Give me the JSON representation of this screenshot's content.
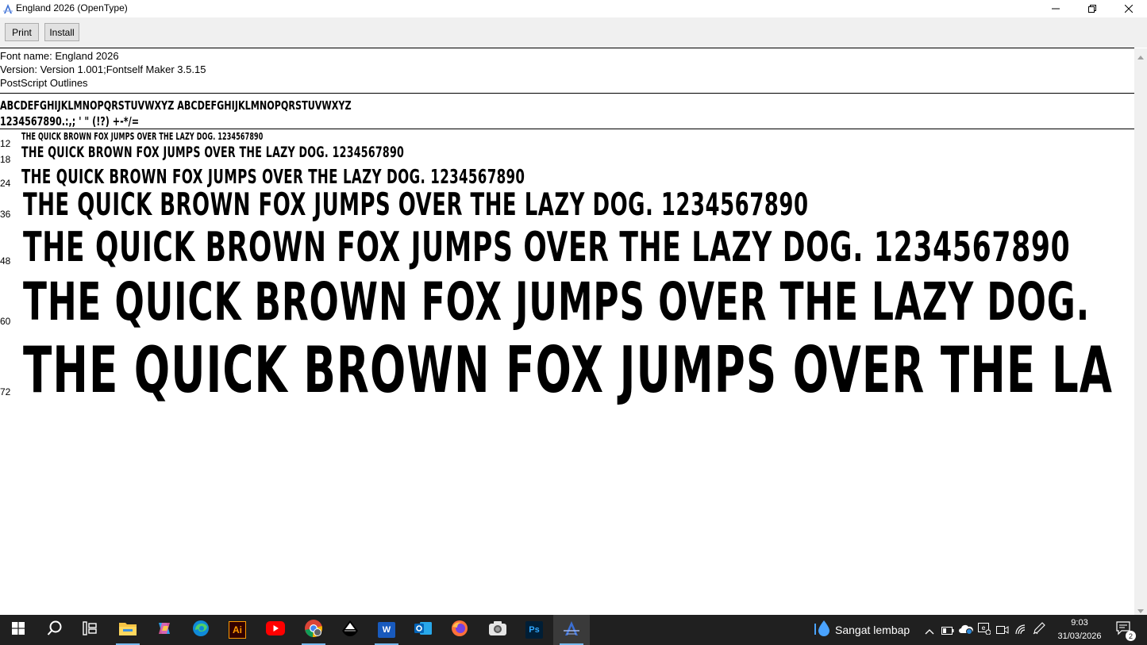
{
  "window": {
    "title": "England 2026 (OpenType)",
    "controls": {
      "minimize_icon": "minimize-icon",
      "restore_icon": "restore-icon",
      "close_icon": "close-icon"
    }
  },
  "toolbar": {
    "print_label": "Print",
    "install_label": "Install"
  },
  "font_info": {
    "name_line": "Font name: England 2026",
    "version_line": "Version: Version 1.001;Fontself Maker 3.5.15",
    "outline_line": "PostScript Outlines"
  },
  "charset": {
    "line1": "ABCDEFGHIJKLMNOPQRSTUVWXYZ ABCDEFGHIJKLMNOPQRSTUVWXYZ",
    "line2": "1234567890.:,; ' \" (!?) +-*/="
  },
  "samples": [
    {
      "size": "12",
      "text": "THE QUICK BROWN FOX JUMPS OVER THE LAZY DOG. 1234567890"
    },
    {
      "size": "18",
      "text": "THE QUICK BROWN FOX JUMPS OVER THE LAZY DOG. 1234567890"
    },
    {
      "size": "24",
      "text": "THE QUICK BROWN FOX JUMPS OVER THE LAZY DOG. 1234567890"
    },
    {
      "size": "36",
      "text": "THE QUICK BROWN FOX JUMPS OVER THE LAZY DOG. 1234567890"
    },
    {
      "size": "48",
      "text": "THE QUICK BROWN FOX JUMPS OVER THE LAZY DOG. 1234567890"
    },
    {
      "size": "60",
      "text": "THE QUICK BROWN FOX JUMPS OVER THE LAZY DOG."
    },
    {
      "size": "72",
      "text": "THE QUICK BROWN FOX JUMPS OVER THE LA"
    }
  ],
  "taskbar": {
    "apps": [
      "start-icon",
      "search-icon",
      "task-view-icon",
      "file-explorer-icon",
      "copilot-icon",
      "edge-icon",
      "illustrator-icon",
      "youtube-icon",
      "chrome-icon",
      "inkscape-icon",
      "word-icon",
      "outlook-icon",
      "firefox-icon",
      "camera-icon",
      "photoshop-icon",
      "font-viewer-icon"
    ],
    "illustrator_label": "Ai",
    "word_label": "W",
    "photoshop_label": "Ps",
    "weather_text": "Sangat lembap",
    "time": "9:03",
    "date": "31/03/2026",
    "notification_count": "2"
  },
  "colors": {
    "taskbar_bg": "#202020",
    "toolbar_bg": "#f0f0f0",
    "accent": "#76b9ed"
  }
}
